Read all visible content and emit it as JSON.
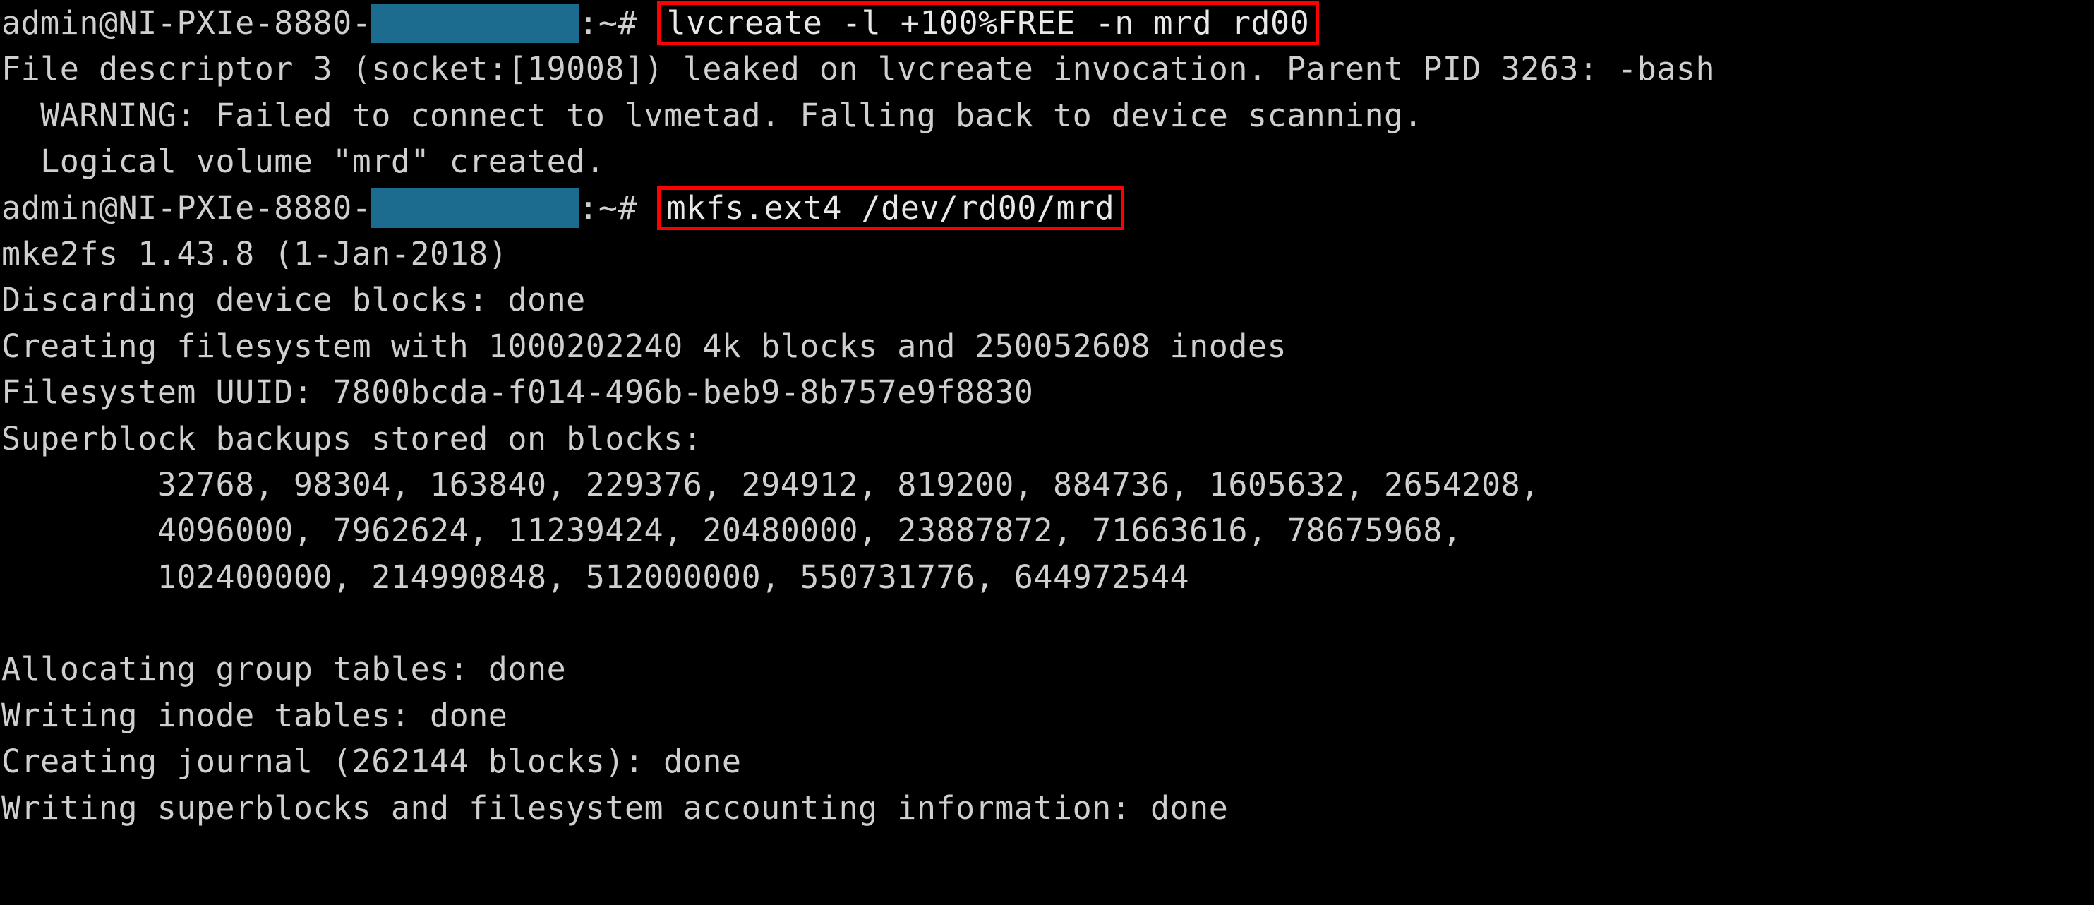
{
  "terminal": {
    "title": "mkfs.ext4 console session",
    "background_color": "#000000",
    "text_color": "#cfcfcf",
    "annotation_color": "#fe0000",
    "redaction_color": "#1b6c8f",
    "prompt_user_host": "admin@NI-PXIe-8880-",
    "prompt_tail": ":~#",
    "lines": [
      {
        "type": "prompt",
        "prompt": "admin@NI-PXIe-8880-",
        "redacted": true,
        "tail": ":~#",
        "command": "lvcreate -l +100%FREE -n mrd rd00",
        "highlighted": true
      },
      {
        "type": "output",
        "text": "File descriptor 3 (socket:[19008]) leaked on lvcreate invocation. Parent PID 3263: -bash"
      },
      {
        "type": "output",
        "text": "  WARNING: Failed to connect to lvmetad. Falling back to device scanning."
      },
      {
        "type": "output",
        "text": "  Logical volume \"mrd\" created."
      },
      {
        "type": "prompt",
        "prompt": "admin@NI-PXIe-8880-",
        "redacted": true,
        "tail": ":~#",
        "command": "mkfs.ext4 /dev/rd00/mrd",
        "highlighted": true
      },
      {
        "type": "output",
        "text": "mke2fs 1.43.8 (1-Jan-2018)"
      },
      {
        "type": "output",
        "text": "Discarding device blocks: done"
      },
      {
        "type": "output",
        "text": "Creating filesystem with 1000202240 4k blocks and 250052608 inodes"
      },
      {
        "type": "output",
        "text": "Filesystem UUID: 7800bcda-f014-496b-beb9-8b757e9f8830"
      },
      {
        "type": "output",
        "text": "Superblock backups stored on blocks:"
      },
      {
        "type": "output",
        "text": "        32768, 98304, 163840, 229376, 294912, 819200, 884736, 1605632, 2654208,"
      },
      {
        "type": "output",
        "text": "        4096000, 7962624, 11239424, 20480000, 23887872, 71663616, 78675968,"
      },
      {
        "type": "output",
        "text": "        102400000, 214990848, 512000000, 550731776, 644972544"
      },
      {
        "type": "blank",
        "text": ""
      },
      {
        "type": "output",
        "text": "Allocating group tables: done"
      },
      {
        "type": "output",
        "text": "Writing inode tables: done"
      },
      {
        "type": "output",
        "text": "Creating journal (262144 blocks): done"
      },
      {
        "type": "output",
        "text": "Writing superblocks and filesystem accounting information: done"
      },
      {
        "type": "blank",
        "text": ""
      }
    ],
    "filesystem": {
      "mke2fs_version": "1.43.8",
      "mke2fs_date": "1-Jan-2018",
      "block_count": "1000202240",
      "block_size": "4k",
      "inode_count": "250052608",
      "uuid": "7800bcda-f014-496b-beb9-8b757e9f8830",
      "journal_blocks": "262144",
      "leaked_fd": "3",
      "leaked_socket": "19008",
      "parent_pid": "3263",
      "parent_process": "-bash",
      "volume_group": "rd00",
      "logical_volume": "mrd",
      "device_path": "/dev/rd00/mrd",
      "superblock_backups": [
        "32768",
        "98304",
        "163840",
        "229376",
        "294912",
        "819200",
        "884736",
        "1605632",
        "2654208",
        "4096000",
        "7962624",
        "11239424",
        "20480000",
        "23887872",
        "71663616",
        "78675968",
        "102400000",
        "214990848",
        "512000000",
        "550731776",
        "644972544"
      ]
    }
  }
}
